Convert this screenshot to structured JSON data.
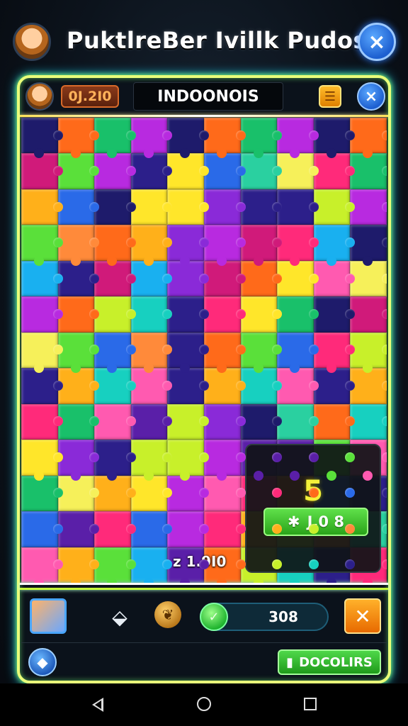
{
  "header": {
    "title": "PuktlreBer Ivillk Pudosla",
    "close_icon": "×"
  },
  "topbar": {
    "score": "0J.2I0",
    "level_name": "INDOONOIS",
    "menu_icon": "☰",
    "close_icon": "×"
  },
  "board": {
    "columns": 10,
    "rows": 13,
    "counter": "z  1.9I0",
    "palette": [
      "#1e1b6b",
      "#2c1f8a",
      "#5a1fa8",
      "#d01a7a",
      "#ff2a7a",
      "#ff6a1a",
      "#ffb01a",
      "#ffe62a",
      "#c8f02a",
      "#5ae03a",
      "#19c06a",
      "#17d0c0",
      "#19b0f0",
      "#2a6ae8",
      "#8a2ad8",
      "#b82ae0",
      "#ff5ab0",
      "#ff8a3a",
      "#f6f05a",
      "#2ad0a0"
    ]
  },
  "overlay": {
    "number": "5",
    "button_icon": "✱",
    "button_value": "J.0 8"
  },
  "toolbar": {
    "gem_icon": "⬙",
    "leaf_icon": "❦",
    "orb_icon": "✓",
    "progress_value": "308",
    "hint_icon": "✕"
  },
  "footer": {
    "diamond_icon": "◆",
    "green_button_icon": "▮",
    "green_button_label": "DOCOLIRS"
  },
  "colors": {
    "frame_neon": "#e9ff7a",
    "accent_blue": "#1d5fd0",
    "accent_green": "#2aa31a",
    "accent_orange": "#e08000"
  }
}
